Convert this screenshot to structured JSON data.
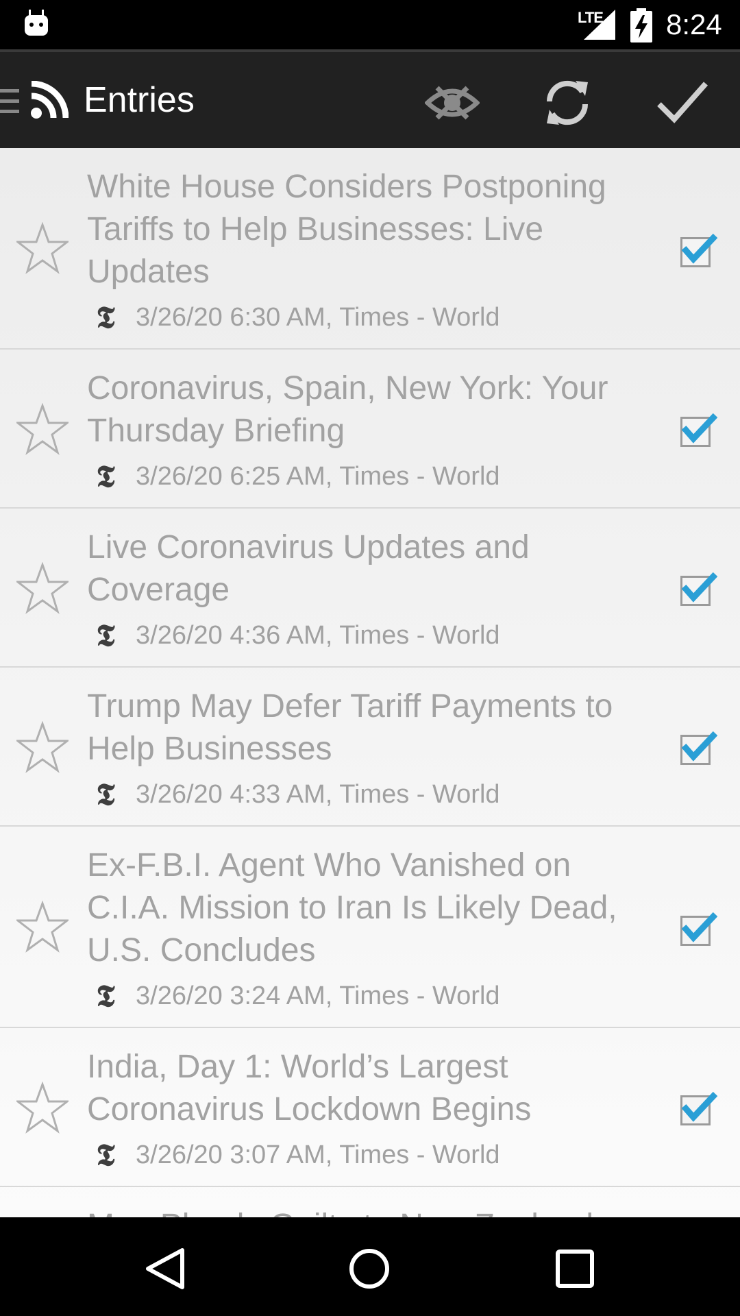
{
  "status": {
    "network": "LTE",
    "time": "8:24"
  },
  "toolbar": {
    "title": "Entries"
  },
  "entries": [
    {
      "title": "White House Considers Postponing Tariffs to Help Businesses: Live Updates",
      "meta": "3/26/20 6:30 AM, Times - World",
      "starred": false,
      "read": true
    },
    {
      "title": "Coronavirus, Spain, New York: Your Thursday Briefing",
      "meta": "3/26/20 6:25 AM, Times - World",
      "starred": false,
      "read": true
    },
    {
      "title": "Live Coronavirus Updates and Coverage",
      "meta": "3/26/20 4:36 AM, Times - World",
      "starred": false,
      "read": true
    },
    {
      "title": "Trump May Defer Tariff Payments to Help Businesses",
      "meta": "3/26/20 4:33 AM, Times - World",
      "starred": false,
      "read": true
    },
    {
      "title": "Ex-F.B.I. Agent Who Vanished on C.I.A. Mission to Iran Is Likely Dead, U.S. Concludes",
      "meta": "3/26/20 3:24 AM, Times - World",
      "starred": false,
      "read": true
    },
    {
      "title": "India, Day 1: World’s Largest Coronavirus Lockdown Begins",
      "meta": "3/26/20 3:07 AM, Times - World",
      "starred": false,
      "read": true
    },
    {
      "title": "Man Pleads Guilty to New Zealand Mosque Attacks",
      "meta": "",
      "starred": false,
      "read": true
    }
  ],
  "icons": {
    "source": "nyt-logo-icon",
    "star": "star-outline-icon",
    "check": "checkbox-checked-icon"
  },
  "colors": {
    "accent": "#2a9fd6",
    "toolbar": "#212121"
  }
}
